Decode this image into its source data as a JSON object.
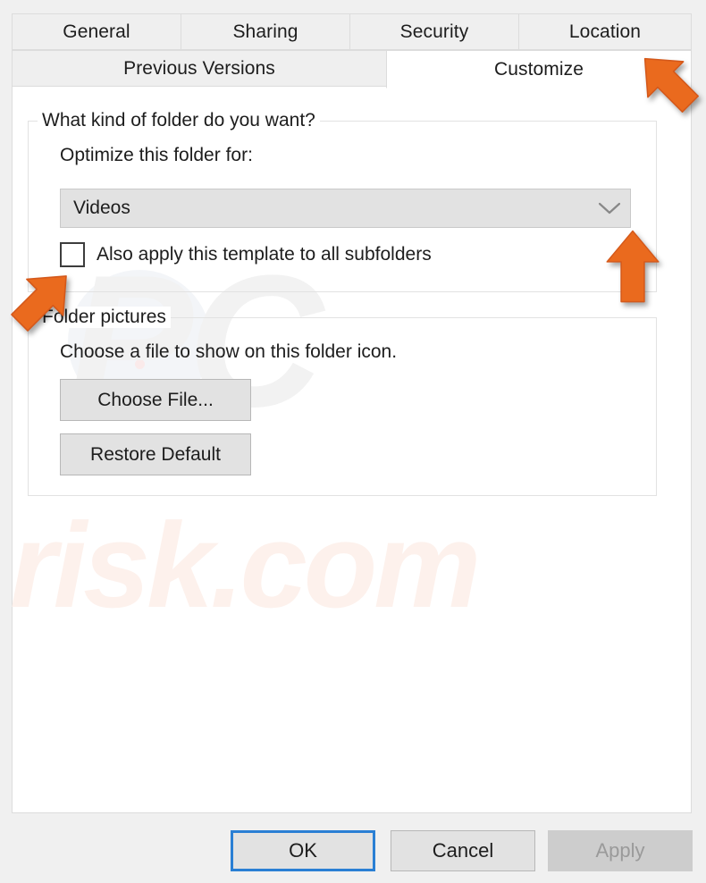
{
  "dialog": {
    "tabs_row1": [
      {
        "label": "General",
        "active": false
      },
      {
        "label": "Sharing",
        "active": false
      },
      {
        "label": "Security",
        "active": false
      },
      {
        "label": "Location",
        "active": false
      }
    ],
    "tabs_row2": [
      {
        "label": "Previous Versions",
        "active": false
      },
      {
        "label": "Customize",
        "active": true
      }
    ],
    "group_folder_kind": {
      "title": "What kind of folder do you want?",
      "optimize_label": "Optimize this folder for:",
      "combo_value": "Videos",
      "combo_icon": "chevron-down-icon",
      "checkbox_label": "Also apply this template to all subfolders",
      "checkbox_checked": false
    },
    "group_folder_pictures": {
      "title": "Folder pictures",
      "description": "Choose a file to show on this folder icon.",
      "choose_file_label": "Choose File...",
      "restore_default_label": "Restore Default"
    },
    "footer": {
      "ok_label": "OK",
      "cancel_label": "Cancel",
      "apply_label": "Apply",
      "apply_enabled": false
    }
  },
  "watermarks": {
    "logo_text": "PC",
    "domain_text": "risk.com"
  },
  "annotations": {
    "arrow_color": "#ea6a1e",
    "arrows": [
      {
        "name": "arrow-to-customize-tab",
        "direction": "up-left"
      },
      {
        "name": "arrow-to-combobox",
        "direction": "up"
      },
      {
        "name": "arrow-to-checkbox",
        "direction": "up-right"
      }
    ]
  },
  "colors": {
    "accent_focus": "#2a7fd4",
    "tab_inactive_bg": "#efefef",
    "panel_bg": "#ffffff",
    "button_bg": "#e2e2e2",
    "disabled_text": "#9a9a9a"
  }
}
